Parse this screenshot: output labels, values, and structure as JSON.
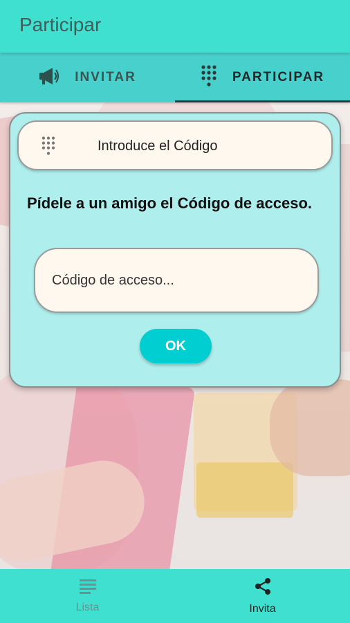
{
  "appbar": {
    "title": "Participar"
  },
  "tabs": [
    {
      "label": "INVITAR",
      "icon": "megaphone-icon",
      "active": false
    },
    {
      "label": "PARTICIPAR",
      "icon": "dialpad-icon",
      "active": true
    }
  ],
  "dialog": {
    "header_text": "Introduce el Código",
    "header_icon": "dialpad-icon",
    "message": "Pídele a un amigo el Código de acceso.",
    "code_input": {
      "value": "",
      "placeholder": "Código de acceso..."
    },
    "ok_label": "OK"
  },
  "bottom_nav": [
    {
      "label": "Lista",
      "icon": "list-icon",
      "active": false
    },
    {
      "label": "Invita",
      "icon": "share-icon",
      "active": true
    }
  ],
  "colors": {
    "appbar": "#40e0d0",
    "tabbar": "#48d1cc",
    "dialog_bg": "#aeeeec",
    "field_bg": "#fff8ee",
    "ok_button": "#00ced1"
  }
}
